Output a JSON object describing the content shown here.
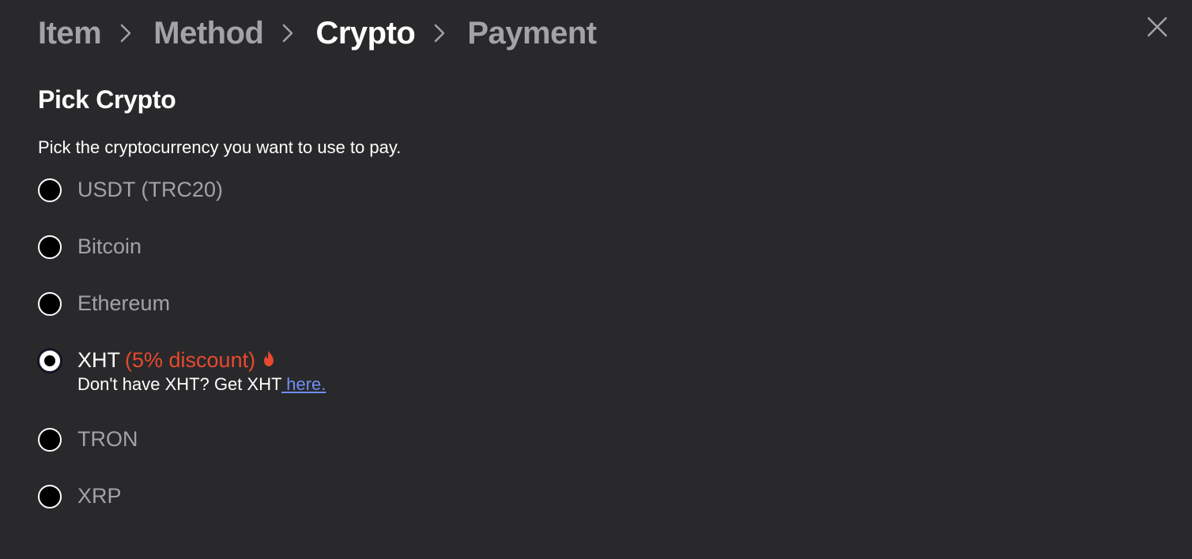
{
  "breadcrumb": {
    "steps": [
      {
        "label": "Item",
        "active": false
      },
      {
        "label": "Method",
        "active": false
      },
      {
        "label": "Crypto",
        "active": true
      },
      {
        "label": "Payment",
        "active": false
      }
    ]
  },
  "header": {
    "title": "Pick Crypto",
    "subtitle": "Pick the cryptocurrency you want to use to pay."
  },
  "options": [
    {
      "label": "USDT (TRC20)",
      "selected": false
    },
    {
      "label": "Bitcoin",
      "selected": false
    },
    {
      "label": "Ethereum",
      "selected": false
    },
    {
      "label": "XHT",
      "selected": true,
      "discount": "(5% discount)",
      "icon": "flame-icon",
      "note_text": "Don't have XHT? Get XHT",
      "note_link": " here."
    },
    {
      "label": "TRON",
      "selected": false
    },
    {
      "label": "XRP",
      "selected": false
    }
  ],
  "colors": {
    "background": "#29292b",
    "inactive_text": "#a3a2a7",
    "active_text": "#ffffff",
    "discount": "#e8492f",
    "link": "#6f8ff5"
  }
}
